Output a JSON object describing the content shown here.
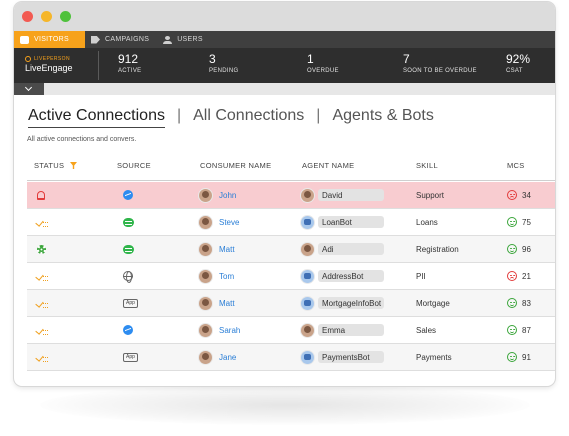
{
  "nav": {
    "visitors": "VISITORS",
    "campaigns": "CAMPAIGNS",
    "users": "USERS"
  },
  "brand": {
    "top": "LIVEPERSON",
    "name": "LiveEngage"
  },
  "stats": [
    {
      "value": "912",
      "label": "ACTIVE"
    },
    {
      "value": "3",
      "label": "PENDING"
    },
    {
      "value": "1",
      "label": "OVERDUE"
    },
    {
      "value": "7",
      "label": "SOON TO BE OVERDUE"
    },
    {
      "value": "92%",
      "label": "CSAT"
    }
  ],
  "tabs": {
    "active": "Active Connections",
    "all": "All Connections",
    "agents": "Agents & Bots",
    "separator": "|"
  },
  "subtitle": "All active connections and convers.",
  "columns": {
    "status": "STATUS",
    "source": "SOURCE",
    "consumer": "CONSUMER NAME",
    "agent": "AGENT NAME",
    "skill": "SKILL",
    "mcs": "MCS"
  },
  "rows": [
    {
      "status": "bell-icon",
      "source": "messenger-icon",
      "consumer": "John",
      "agent": "David",
      "agent_type": "human",
      "skill": "Support",
      "mcs": "34",
      "mcs_mood": "negative"
    },
    {
      "status": "waiting-icon",
      "source": "sms-icon",
      "consumer": "Steve",
      "agent": "LoanBot",
      "agent_type": "bot",
      "skill": "Loans",
      "mcs": "75",
      "mcs_mood": "positive"
    },
    {
      "status": "gear-icon",
      "source": "sms-icon",
      "consumer": "Matt",
      "agent": "Adi",
      "agent_type": "human",
      "skill": "Registration",
      "mcs": "96",
      "mcs_mood": "positive"
    },
    {
      "status": "waiting-icon",
      "source": "globe-icon",
      "consumer": "Tom",
      "agent": "AddressBot",
      "agent_type": "bot",
      "skill": "PII",
      "mcs": "21",
      "mcs_mood": "negative"
    },
    {
      "status": "waiting-icon",
      "source": "app-icon",
      "consumer": "Matt",
      "agent": "MortgageInfoBot",
      "agent_type": "bot",
      "skill": "Mortgage",
      "mcs": "83",
      "mcs_mood": "positive"
    },
    {
      "status": "waiting-icon",
      "source": "messenger-icon",
      "consumer": "Sarah",
      "agent": "Emma",
      "agent_type": "human",
      "skill": "Sales",
      "mcs": "87",
      "mcs_mood": "positive"
    },
    {
      "status": "waiting-icon",
      "source": "app-icon",
      "consumer": "Jane",
      "agent": "PaymentsBot",
      "agent_type": "bot",
      "skill": "Payments",
      "mcs": "91",
      "mcs_mood": "positive"
    }
  ],
  "source_labels": {
    "app": "App"
  },
  "colors": {
    "accent": "#f7a21b",
    "alert_row": "#f8ccd0",
    "link": "#2a7ed6",
    "positive": "#3aa53a",
    "negative": "#e23b3b"
  }
}
